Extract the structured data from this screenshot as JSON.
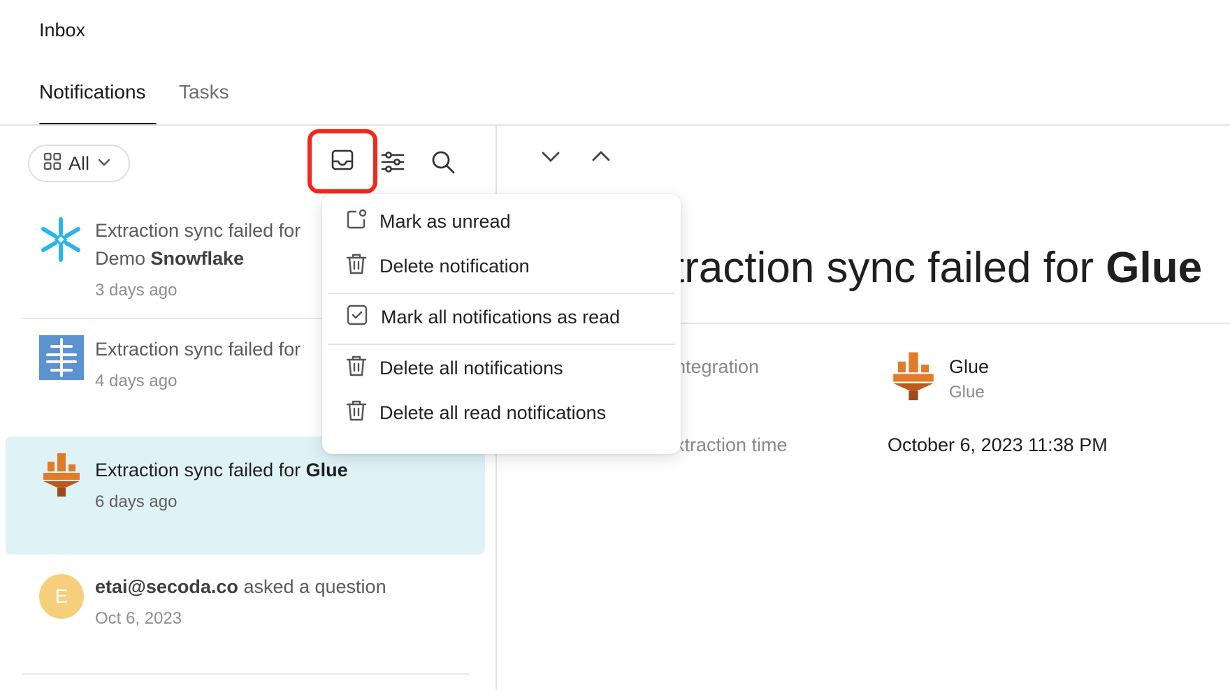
{
  "header": {
    "title": "Inbox"
  },
  "tabs": [
    {
      "label": "Notifications",
      "active": true
    },
    {
      "label": "Tasks",
      "active": false
    }
  ],
  "toolbar": {
    "filter_label": "All",
    "icons": [
      "inbox-icon",
      "filter-sliders-icon",
      "search-icon"
    ],
    "highlight_color": "#f5261a"
  },
  "notifications": [
    {
      "prefix": "Extraction sync failed for",
      "line2_prefix": "Demo",
      "line2_bold": "Snowflake",
      "time": "3 days ago",
      "icon": "snowflake-logo"
    },
    {
      "prefix": "Extraction sync failed for",
      "time": "4 days ago",
      "icon": "integration-logo"
    },
    {
      "prefix": "Extraction sync failed for",
      "bold": "Glue",
      "time": "6 days ago",
      "icon": "aws-glue-logo",
      "selected": true
    },
    {
      "bold_prefix": "etai@secoda.co",
      "text": "asked a question",
      "time": "Oct 6, 2023",
      "avatar_letter": "E",
      "avatar_color": "#f6cf7a"
    }
  ],
  "menu": {
    "items": [
      {
        "label": "Mark as unread",
        "icon": "mark-unread-icon"
      },
      {
        "label": "Delete notification",
        "icon": "trash-icon"
      },
      {
        "label": "Mark all notifications as read",
        "icon": "checkbox-icon"
      },
      {
        "label": "Delete all notifications",
        "icon": "trash-icon"
      },
      {
        "label": "Delete all read notifications",
        "icon": "trash-icon"
      }
    ]
  },
  "detail": {
    "title_prefix": "traction sync failed for",
    "title_bold": "Glue",
    "properties": [
      {
        "label": "ntegration",
        "value_title": "Glue",
        "value_subtitle": "Glue"
      },
      {
        "label": "xtraction time",
        "value": "October 6, 2023 11:38 PM"
      }
    ]
  },
  "colors": {
    "selected_row": "#dff3f7",
    "snowflake": "#29b5e8",
    "glue_orange": "#e07b2a"
  }
}
